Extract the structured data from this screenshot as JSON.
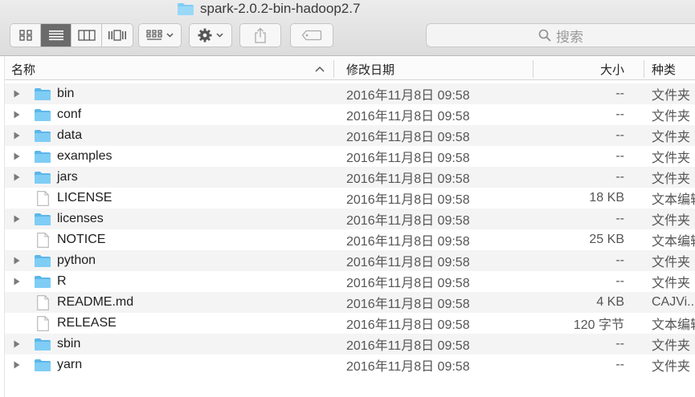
{
  "window": {
    "title": "spark-2.0.2-bin-hadoop2.7",
    "title_icon": "folder-icon"
  },
  "toolbar": {
    "view_buttons": [
      {
        "icon": "icon-view-icon",
        "active": false
      },
      {
        "icon": "list-view-icon",
        "active": true
      },
      {
        "icon": "column-view-icon",
        "active": false
      },
      {
        "icon": "cover-flow-icon",
        "active": false
      }
    ],
    "arrange_icon": "arrange-grid-icon",
    "action_icon": "gear-icon",
    "share_icon": "share-icon",
    "tag_icon": "tag-icon",
    "search_placeholder": "搜索"
  },
  "columns": {
    "name": "名称",
    "date": "修改日期",
    "size": "大小",
    "kind": "种类"
  },
  "files": [
    {
      "name": "bin",
      "type": "folder",
      "date": "2016年11月8日 09:58",
      "size": "--",
      "kind": "文件夹"
    },
    {
      "name": "conf",
      "type": "folder",
      "date": "2016年11月8日 09:58",
      "size": "--",
      "kind": "文件夹"
    },
    {
      "name": "data",
      "type": "folder",
      "date": "2016年11月8日 09:58",
      "size": "--",
      "kind": "文件夹"
    },
    {
      "name": "examples",
      "type": "folder",
      "date": "2016年11月8日 09:58",
      "size": "--",
      "kind": "文件夹"
    },
    {
      "name": "jars",
      "type": "folder",
      "date": "2016年11月8日 09:58",
      "size": "--",
      "kind": "文件夹"
    },
    {
      "name": "LICENSE",
      "type": "document",
      "date": "2016年11月8日 09:58",
      "size": "18 KB",
      "kind": "文本编辑"
    },
    {
      "name": "licenses",
      "type": "folder",
      "date": "2016年11月8日 09:58",
      "size": "--",
      "kind": "文件夹"
    },
    {
      "name": "NOTICE",
      "type": "document",
      "date": "2016年11月8日 09:58",
      "size": "25 KB",
      "kind": "文本编辑"
    },
    {
      "name": "python",
      "type": "folder",
      "date": "2016年11月8日 09:58",
      "size": "--",
      "kind": "文件夹"
    },
    {
      "name": "R",
      "type": "folder",
      "date": "2016年11月8日 09:58",
      "size": "--",
      "kind": "文件夹"
    },
    {
      "name": "README.md",
      "type": "document",
      "date": "2016年11月8日 09:58",
      "size": "4 KB",
      "kind": "CAJVi..."
    },
    {
      "name": "RELEASE",
      "type": "document",
      "date": "2016年11月8日 09:58",
      "size": "120 字节",
      "kind": "文本编辑"
    },
    {
      "name": "sbin",
      "type": "folder",
      "date": "2016年11月8日 09:58",
      "size": "--",
      "kind": "文件夹"
    },
    {
      "name": "yarn",
      "type": "folder",
      "date": "2016年11月8日 09:58",
      "size": "--",
      "kind": "文件夹"
    }
  ],
  "colors": {
    "folder": "#7fcdf5",
    "folder_tab": "#5cb6ea",
    "active_view": "#6b6b6b"
  }
}
